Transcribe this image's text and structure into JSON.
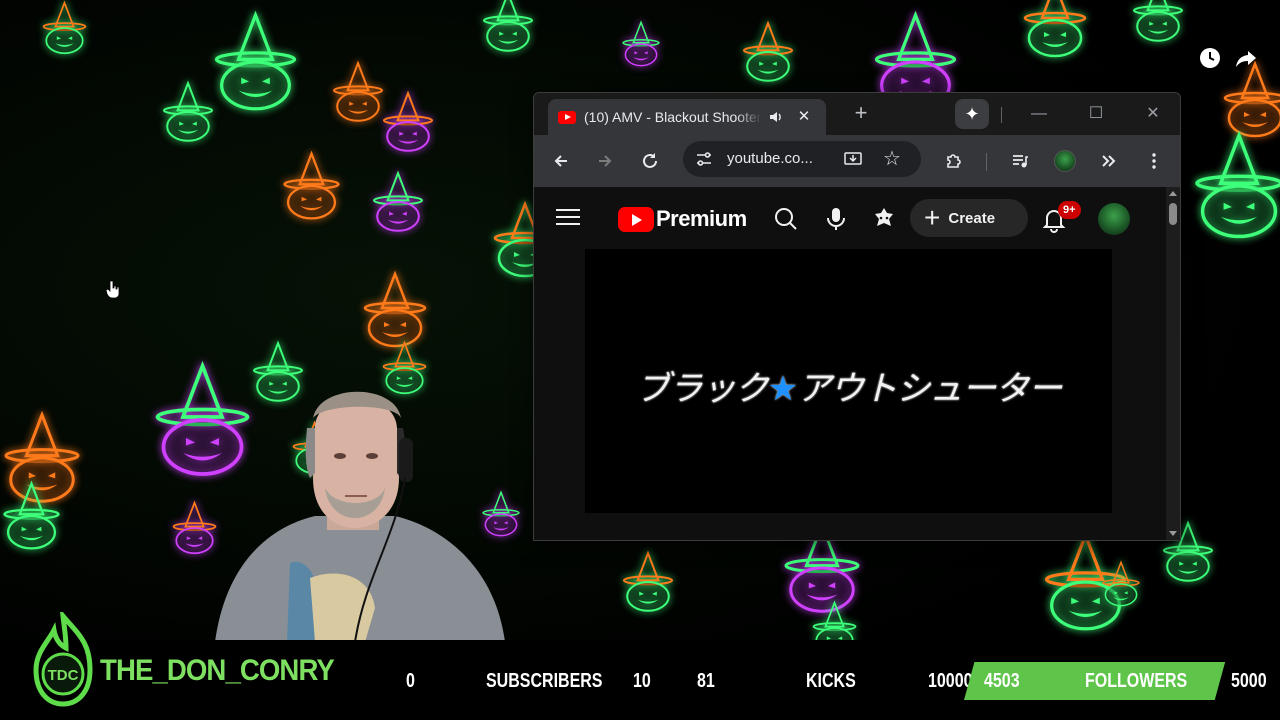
{
  "browser": {
    "tab_title": "(10) AMV - Blackout Shooter",
    "new_tab_label": "+",
    "url": "youtube.co...",
    "window_controls": [
      "—",
      "☐",
      "✕"
    ]
  },
  "youtube": {
    "logo_text": "Premium",
    "create_label": "Create",
    "notification_badge": "9+",
    "video_title_left": "ブラック",
    "video_title_star": "★",
    "video_title_right": "アウトシューター"
  },
  "overlay": {
    "channel_name": "THE_DON_CONRY",
    "logo_letters": "TDC",
    "subscribers_count": "0",
    "subscribers_label": "SUBSCRIBERS",
    "subscribers_goal": "10",
    "kicks_count": "81",
    "kicks_label": "KICKS",
    "kicks_goal": "10000",
    "followers_count": "4503",
    "followers_label": "FOLLOWERS",
    "followers_goal": "5000",
    "followers_progress": 0.9006
  },
  "colors": {
    "neon_green": "#3dff7a",
    "neon_orange": "#ff7a1a",
    "neon_purple": "#d040ff",
    "follow_bar": "#5fc44a",
    "yt_red": "#ff0000"
  }
}
